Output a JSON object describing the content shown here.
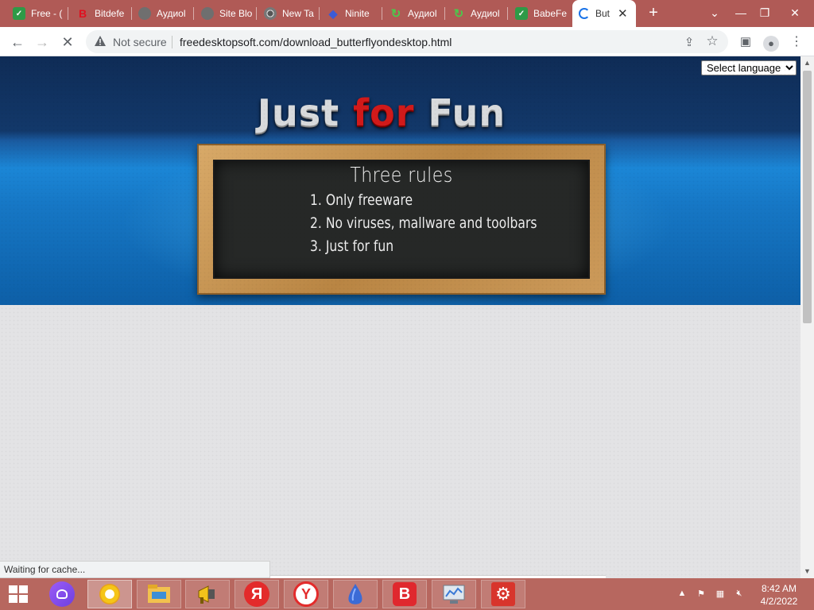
{
  "browser": {
    "tabs": [
      {
        "label": "Free - (",
        "icon": "green-check-favicon"
      },
      {
        "label": "Bitdefe",
        "icon": "bitdefender-favicon"
      },
      {
        "label": "Аудиоl",
        "icon": "gray-globe-favicon"
      },
      {
        "label": "Site Blo",
        "icon": "gray-globe-favicon"
      },
      {
        "label": "New Ta",
        "icon": "chrome-favicon"
      },
      {
        "label": "Ninite",
        "icon": "ninite-favicon"
      },
      {
        "label": "Аудиоl",
        "icon": "green-loop-favicon"
      },
      {
        "label": "Аудиоl",
        "icon": "green-loop-favicon"
      },
      {
        "label": "BabeFe",
        "icon": "green-check-favicon"
      },
      {
        "label": "But",
        "icon": "loading-spinner-icon"
      }
    ],
    "new_tab_label": "+",
    "security_label": "Not secure",
    "url": "freedesktopsoft.com/download_butterflyondesktop.html",
    "status_text": "Waiting for cache..."
  },
  "page": {
    "title_part1": "Just ",
    "title_part2": "for",
    "title_part3": " Fun",
    "language_select": "Select language",
    "board_title": "Three rules",
    "rules": [
      "1. Only freeware",
      "2. No viruses, mallware and toolbars",
      "3. Just for fun"
    ]
  },
  "taskbar": {
    "items": [
      "windows-start",
      "alice-assistant",
      "chrome",
      "file-explorer",
      "megaphone-app",
      "yandex-ya",
      "yandex-browser",
      "droplet-app",
      "vivaldi-b",
      "network-monitor",
      "gear-app"
    ],
    "time": "8:42 AM",
    "date": "4/2/2022"
  },
  "colors": {
    "tabstrip": "#b05a56",
    "taskbar": "#b7675f",
    "header_blue": "#1b86d6",
    "title_red": "#d11a1a"
  }
}
